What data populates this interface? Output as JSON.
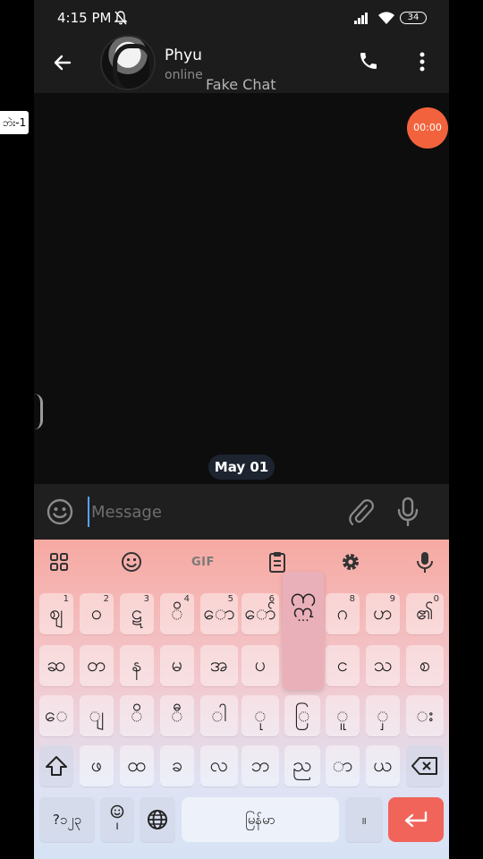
{
  "status_bar": {
    "time": "4:15 PM",
    "battery": "34"
  },
  "header": {
    "contact_name": "Phyu",
    "contact_status": "online",
    "watermark": "Fake Chat"
  },
  "side_label": "ဘဲး-1",
  "timer_badge": "00:00",
  "date_chip": "May 01",
  "composer": {
    "placeholder": "Message"
  },
  "keyboard": {
    "toolbar": {
      "gif_label": "GIF"
    },
    "popup": {
      "char": "ဣ",
      "more": "..."
    },
    "row1": [
      {
        "label": "ဈ",
        "hint": "1"
      },
      {
        "label": "ဝ",
        "hint": "2"
      },
      {
        "label": "ဋ",
        "hint": "3"
      },
      {
        "label": "ိ",
        "hint": "4"
      },
      {
        "label": "ော",
        "hint": "5"
      },
      {
        "label": "ော်",
        "hint": "6"
      },
      {
        "label": "ဂ",
        "hint": "8"
      },
      {
        "label": "ဟ",
        "hint": "9"
      },
      {
        "label": "၏",
        "hint": "0"
      }
    ],
    "row2": [
      "ဆ",
      "တ",
      "န",
      "မ",
      "အ",
      "ပ",
      "င",
      "သ",
      "စ"
    ],
    "row3": [
      "ေ",
      "ျ",
      "ိ",
      "ီ",
      "ါ",
      "ု",
      "ြ",
      "ူ",
      "ှ",
      "း"
    ],
    "row4": [
      "ဖ",
      "ထ",
      "ခ",
      "လ",
      "ဘ",
      "ည",
      "ာ",
      "ယ"
    ],
    "bottom": {
      "symbols": "?၁၂၃",
      "emoji_sub": "ı",
      "space": "မြန်မာ",
      "period": "။"
    }
  },
  "colors": {
    "accent_orange": "#f2633d",
    "enter_key": "#f0645a",
    "cursor": "#5aa0ff"
  }
}
